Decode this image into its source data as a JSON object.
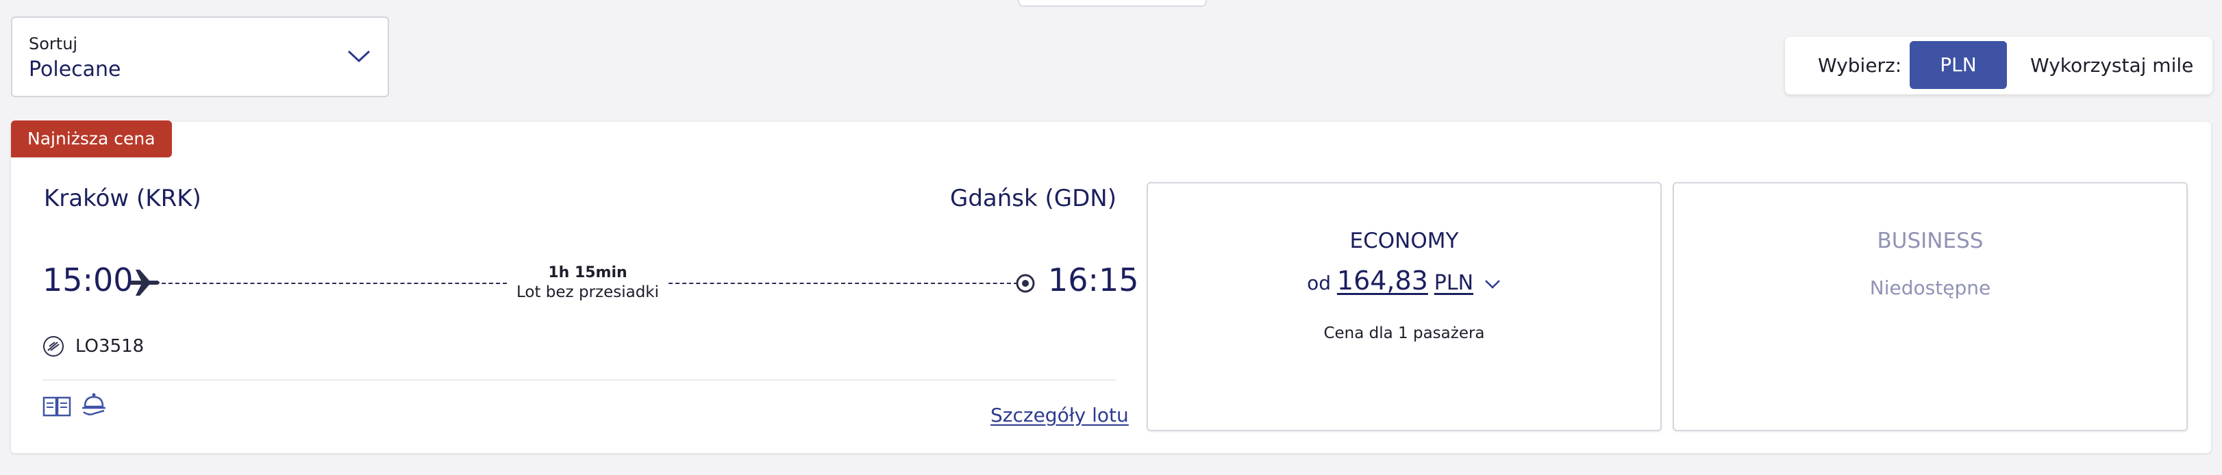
{
  "sort": {
    "label": "Sortuj",
    "value": "Polecane"
  },
  "currency": {
    "label": "Wybierz:",
    "selected": "PLN",
    "alternative": "Wykorzystaj mile",
    "accent_color": "#3e53a4"
  },
  "flight": {
    "badge": "Najniższa cena",
    "badge_color": "#b8392a",
    "origin": "Kraków (KRK)",
    "destination": "Gdańsk (GDN)",
    "departure_time": "15:00",
    "arrival_time": "16:15",
    "duration": "1h 15min",
    "stops": "Lot bez przesiadki",
    "flight_number": "LO3518",
    "details_link": "Szczegóły lotu",
    "icons": [
      "plane-icon",
      "destination-icon",
      "airline-logo-icon",
      "book-icon",
      "meal-icon"
    ]
  },
  "fares": {
    "economy": {
      "title": "ECONOMY",
      "price_prefix": "od",
      "price": "164,83",
      "currency": "PLN",
      "note": "Cena dla 1 pasażera"
    },
    "business": {
      "title": "BUSINESS",
      "status": "Niedostępne"
    }
  }
}
